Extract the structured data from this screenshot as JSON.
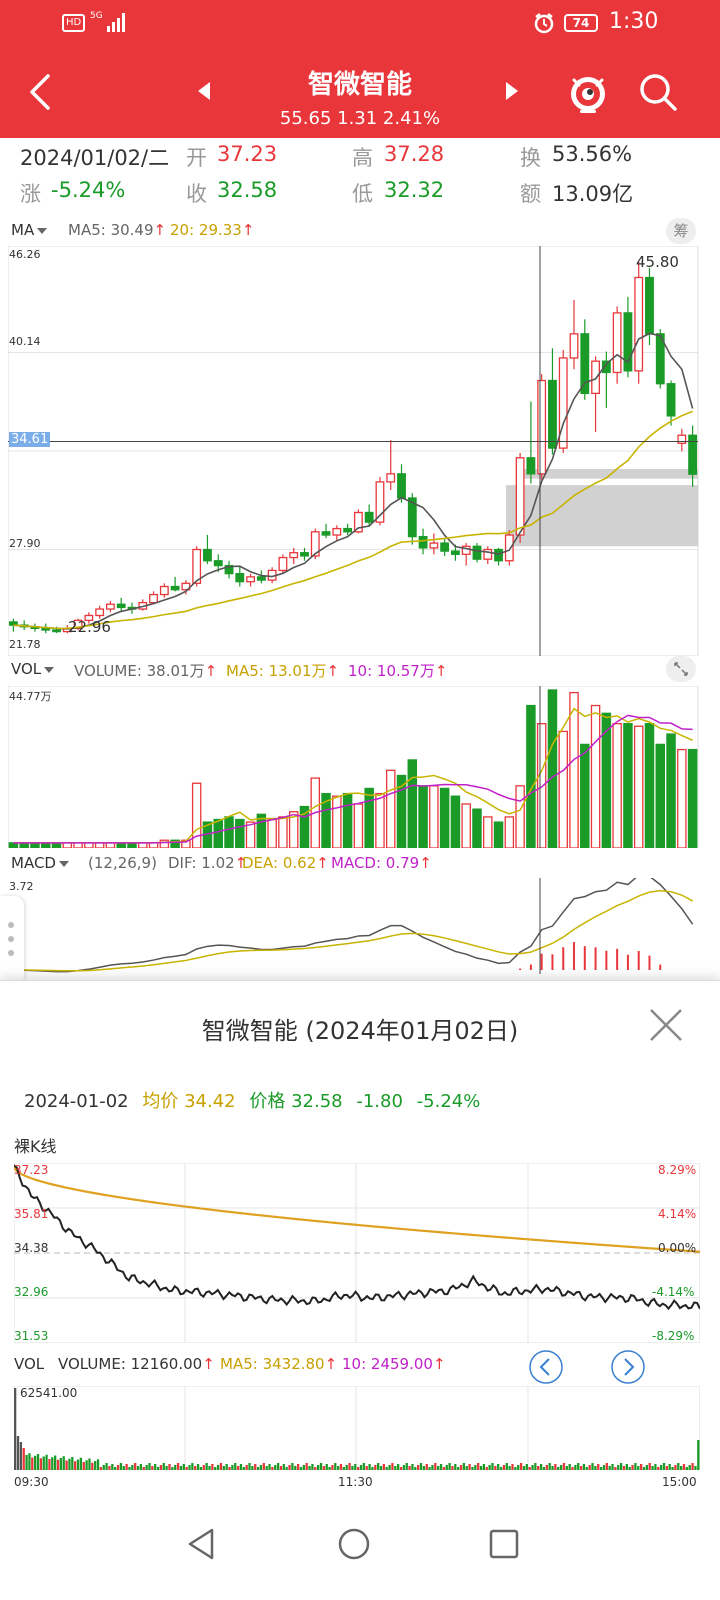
{
  "status_bar": {
    "hd": "HD",
    "network": "5G",
    "battery": "74",
    "time": "1:30"
  },
  "header": {
    "title": "智微智能",
    "subtitle": "55.65 1.31 2.41%"
  },
  "quote": {
    "date": "2024/01/02/二",
    "open_label": "开",
    "open": "37.23",
    "high_label": "高",
    "high": "37.28",
    "turnover_label": "换",
    "turnover": "53.56%",
    "change_label": "涨",
    "change": "-5.24%",
    "close_label": "收",
    "close": "32.58",
    "low_label": "低",
    "low": "32.32",
    "amount_label": "额",
    "amount": "13.09亿"
  },
  "kline": {
    "indicator": "MA",
    "ma5": "MA5: 30.49",
    "ma20": "20: 29.33",
    "chip_button": "筹",
    "y_labels": [
      "46.26",
      "40.14",
      "27.90",
      "21.78"
    ],
    "crosshair_value": "34.61",
    "max_label": "45.80",
    "min_label": "22.96",
    "candles": [
      [
        23.4,
        23.6,
        22.8,
        23.2
      ],
      [
        23.2,
        23.5,
        22.9,
        23.1
      ],
      [
        23.1,
        23.3,
        22.8,
        23.0
      ],
      [
        23.0,
        23.3,
        22.7,
        22.9
      ],
      [
        22.9,
        23.1,
        22.7,
        22.8
      ],
      [
        22.8,
        23.2,
        22.7,
        23.0
      ],
      [
        23.0,
        23.6,
        22.9,
        23.5
      ],
      [
        23.5,
        24.0,
        23.3,
        23.8
      ],
      [
        23.8,
        24.4,
        23.6,
        24.2
      ],
      [
        24.2,
        24.7,
        24.0,
        24.5
      ],
      [
        24.5,
        24.9,
        24.0,
        24.3
      ],
      [
        24.3,
        24.6,
        23.9,
        24.2
      ],
      [
        24.2,
        24.8,
        24.1,
        24.6
      ],
      [
        24.6,
        25.3,
        24.5,
        25.1
      ],
      [
        25.1,
        25.8,
        24.9,
        25.6
      ],
      [
        25.6,
        26.2,
        25.3,
        25.4
      ],
      [
        25.4,
        26.0,
        25.1,
        25.8
      ],
      [
        25.8,
        28.1,
        25.6,
        27.9
      ],
      [
        27.9,
        28.8,
        27.0,
        27.2
      ],
      [
        27.2,
        27.6,
        26.5,
        26.9
      ],
      [
        26.9,
        27.2,
        26.1,
        26.4
      ],
      [
        26.4,
        26.9,
        25.6,
        25.9
      ],
      [
        25.9,
        26.4,
        25.6,
        26.2
      ],
      [
        26.2,
        26.6,
        25.8,
        26.0
      ],
      [
        26.0,
        26.8,
        25.8,
        26.6
      ],
      [
        26.6,
        27.6,
        26.4,
        27.4
      ],
      [
        27.4,
        28.0,
        27.0,
        27.7
      ],
      [
        27.7,
        28.0,
        27.2,
        27.5
      ],
      [
        27.5,
        29.2,
        27.3,
        29.0
      ],
      [
        29.0,
        29.5,
        28.6,
        28.8
      ],
      [
        28.8,
        29.4,
        28.4,
        29.2
      ],
      [
        29.2,
        29.5,
        28.8,
        29.0
      ],
      [
        29.0,
        30.4,
        28.9,
        30.2
      ],
      [
        30.2,
        30.7,
        29.3,
        29.6
      ],
      [
        29.6,
        32.4,
        29.4,
        32.1
      ],
      [
        32.1,
        34.7,
        31.6,
        32.6
      ],
      [
        32.6,
        33.2,
        30.8,
        31.1
      ],
      [
        31.1,
        31.4,
        28.2,
        28.7
      ],
      [
        28.7,
        29.2,
        27.6,
        28.0
      ],
      [
        28.0,
        28.9,
        27.6,
        28.3
      ],
      [
        28.3,
        28.6,
        27.5,
        27.8
      ],
      [
        27.8,
        28.2,
        27.2,
        27.6
      ],
      [
        27.6,
        28.3,
        26.9,
        28.1
      ],
      [
        28.1,
        28.3,
        27.1,
        27.3
      ],
      [
        27.3,
        28.1,
        27.0,
        27.9
      ],
      [
        27.9,
        28.0,
        26.9,
        27.2
      ],
      [
        27.2,
        29.1,
        26.9,
        28.8
      ],
      [
        28.8,
        33.9,
        28.3,
        33.6
      ],
      [
        33.6,
        37.1,
        32.0,
        32.6
      ],
      [
        32.6,
        38.8,
        32.2,
        38.4
      ],
      [
        38.4,
        40.4,
        33.8,
        34.2
      ],
      [
        34.2,
        40.3,
        33.9,
        39.8
      ],
      [
        39.8,
        43.4,
        39.1,
        41.3
      ],
      [
        41.3,
        42.2,
        37.2,
        37.6
      ],
      [
        37.6,
        39.9,
        35.2,
        39.6
      ],
      [
        39.6,
        40.2,
        36.7,
        38.9
      ],
      [
        38.9,
        43.0,
        38.2,
        42.6
      ],
      [
        42.6,
        43.6,
        38.6,
        39.0
      ],
      [
        39.0,
        45.8,
        38.2,
        44.8
      ],
      [
        44.8,
        45.4,
        40.6,
        41.3
      ],
      [
        41.3,
        41.6,
        37.9,
        38.2
      ],
      [
        38.2,
        38.4,
        35.6,
        36.2
      ],
      [
        34.5,
        35.4,
        34.0,
        35.0
      ],
      [
        35.0,
        35.6,
        31.8,
        32.58
      ]
    ]
  },
  "vol": {
    "indicator": "VOL",
    "volume": "VOLUME: 38.01万",
    "ma5": "MA5: 13.01万",
    "ma10": "10: 10.57万",
    "y_label": "44.77万",
    "values": [
      2,
      2,
      2,
      2,
      2,
      2,
      2,
      2,
      2,
      2,
      2,
      2,
      2,
      2,
      3,
      3,
      3,
      25,
      10,
      11,
      12,
      11,
      10,
      13,
      11,
      12,
      14,
      16,
      27,
      21,
      20,
      21,
      17,
      23,
      21,
      30,
      28,
      34,
      24,
      24,
      23,
      20,
      17,
      15,
      12,
      10,
      12,
      24,
      55,
      48,
      61,
      45,
      60,
      40,
      55,
      52,
      48,
      48,
      47,
      48,
      40,
      44,
      38,
      38
    ]
  },
  "macd": {
    "indicator": "MACD",
    "params": "(12,26,9)",
    "dif": "DIF: 1.02",
    "dea": "DEA: 0.62",
    "macd": "MACD: 0.79",
    "y_label": "3.72"
  },
  "intraday": {
    "title": "智微智能 (2024年01月02日)",
    "date": "2024-01-02",
    "avg_label": "均价 34.42",
    "price_label": "价格 32.58",
    "change": "-1.80",
    "change_pct": "-5.24%",
    "chart_label": "裸K线",
    "y_left": [
      "37.23",
      "35.81",
      "34.38",
      "32.96",
      "31.53"
    ],
    "y_right": [
      "8.29%",
      "4.14%",
      "0.00%",
      "-4.14%",
      "-8.29%"
    ],
    "vol_label": "VOL",
    "vol_volume": "VOLUME: 12160.00",
    "vol_ma5": "MA5: 3432.80",
    "vol_ma10": "10: 2459.00",
    "vol_y": "62541.00",
    "times": [
      "09:30",
      "11:30",
      "15:00"
    ]
  },
  "colors": {
    "up": "#e8363a",
    "down": "#1a9b28",
    "ma5": "#555555",
    "ma20": "#c8b400",
    "ma10": "#c020c8",
    "header": "#e8363a"
  }
}
